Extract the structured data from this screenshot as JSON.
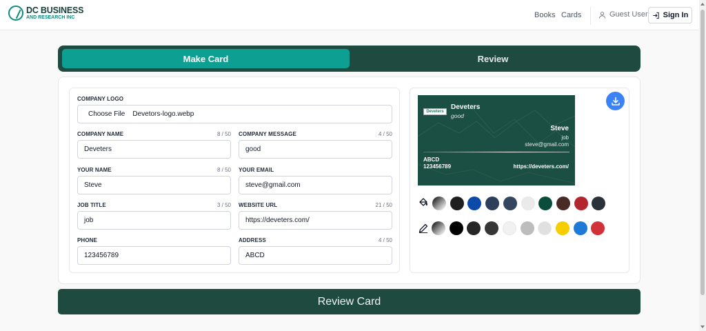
{
  "brand": {
    "line1": "DC BUSINESS",
    "line2": "AND RESEARCH INC"
  },
  "nav": {
    "books": "Books",
    "cards": "Cards",
    "guest": "Guest User",
    "signin": "Sign In"
  },
  "tabs": {
    "make": "Make Card",
    "review": "Review"
  },
  "form": {
    "logo_label": "COMPANY LOGO",
    "choose_file": "Choose File",
    "file_name": "Devetors-logo.webp",
    "company_name": {
      "label": "COMPANY NAME",
      "count": "8 / 50",
      "value": "Deveters"
    },
    "company_message": {
      "label": "COMPANY MESSAGE",
      "count": "4 / 50",
      "value": "good"
    },
    "your_name": {
      "label": "YOUR NAME",
      "count": "8 / 50",
      "value": "Steve"
    },
    "your_email": {
      "label": "YOUR EMAIL",
      "count": "",
      "value": "steve@gmail.com"
    },
    "job_title": {
      "label": "JOB TITLE",
      "count": "3 / 50",
      "value": "job"
    },
    "website": {
      "label": "WEBSITE URL",
      "count": "21 / 50",
      "value": "https://deveters.com/"
    },
    "phone": {
      "label": "PHONE",
      "count": "",
      "value": "123456789"
    },
    "address": {
      "label": "ADDRESS",
      "count": "4 / 50",
      "value": "ABCD"
    }
  },
  "card": {
    "logo_text": "Deveters",
    "company": "Deveters",
    "message": "good",
    "name": "Steve",
    "job": "job",
    "email": "steve@gmail.com",
    "address": "ABCD",
    "phone": "123456789",
    "website": "https://deveters.com/",
    "background_color": "#1c4f43"
  },
  "palette": {
    "background_colors": [
      "gradient-gray",
      "#1f1f1f",
      "#0b4aa8",
      "#2c3e5a",
      "#33465d",
      "#eaeaea",
      "#0a4d3c",
      "#4a2a24",
      "#b3262d",
      "#2a3138"
    ],
    "text_colors": [
      "gradient-gray",
      "#000000",
      "#262626",
      "#363636",
      "#f1f1f1",
      "#bdbdbd",
      "#e0e0e0",
      "#f5cd00",
      "#1d7ad7",
      "#d13138"
    ],
    "icons": {
      "background": "paint-bucket-icon",
      "text": "pencil-icon"
    }
  },
  "review_button": "Review Card"
}
